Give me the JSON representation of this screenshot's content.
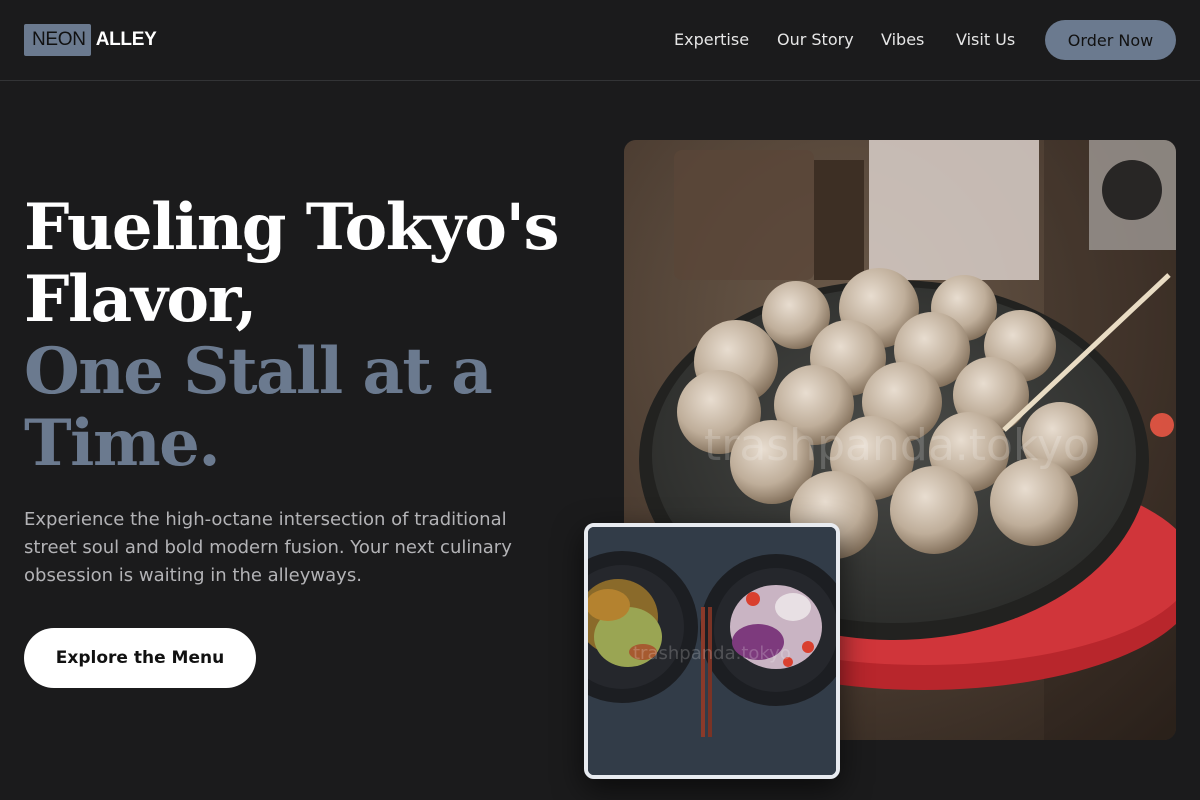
{
  "brand": {
    "part1": "NEON",
    "part2": "ALLEY"
  },
  "nav": {
    "items": [
      "Expertise",
      "Our Story",
      "Vibes",
      "Visit Us"
    ],
    "cta_label": "Order Now"
  },
  "hero": {
    "line1": "Fueling Tokyo's",
    "line2": "Flavor,",
    "line3": "One Stall at a",
    "line4": "Time.",
    "description": "Experience the high-octane intersection of traditional street soul and bold modern fusion. Your next culinary obsession is waiting in the alleyways.",
    "cta_label": "Explore the Menu"
  },
  "images": {
    "main_watermark": "trashpanda.tokyo",
    "small_watermark": "trashpanda.tokyo"
  },
  "colors": {
    "background": "#1b1b1c",
    "accent": "#6b7a8f",
    "text_primary": "#ffffff",
    "text_muted": "#b3b3b6"
  }
}
